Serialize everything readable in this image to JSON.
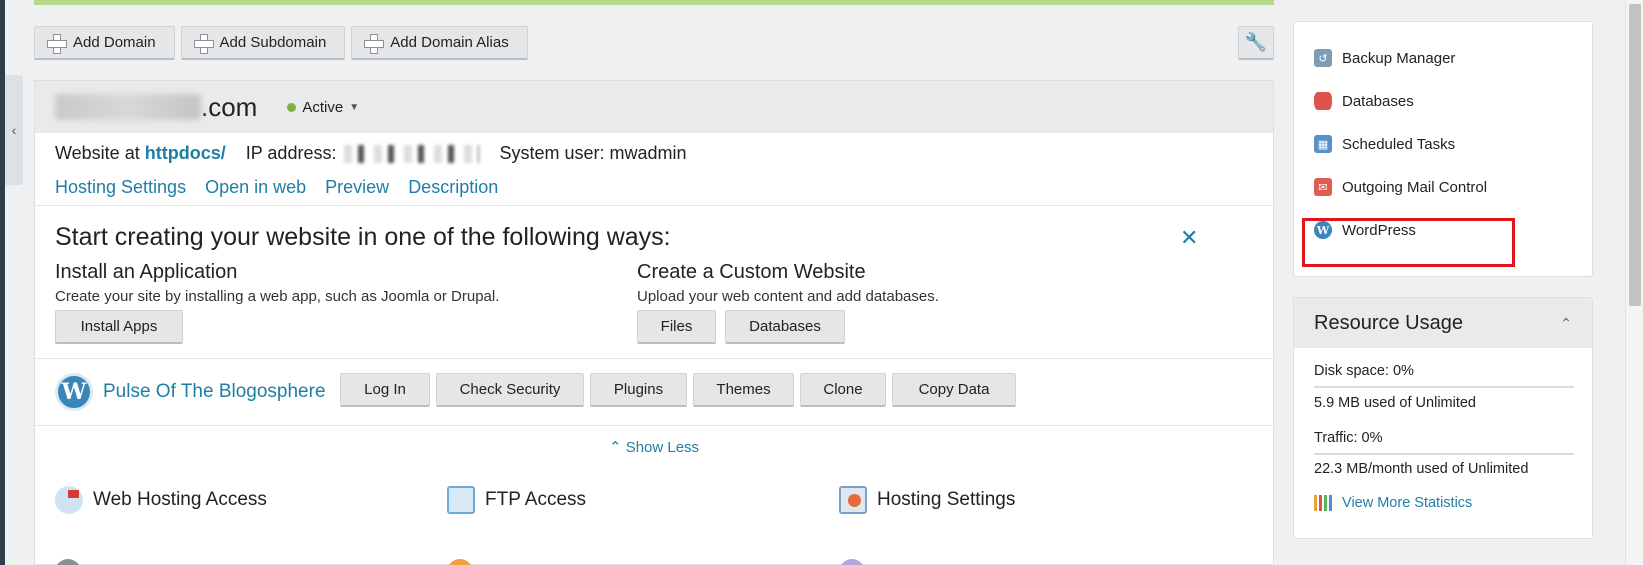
{
  "toolbar": {
    "add_domain": "Add Domain",
    "add_subdomain": "Add Subdomain",
    "add_domain_alias": "Add Domain Alias"
  },
  "domain": {
    "tld": ".com",
    "status": "Active"
  },
  "info": {
    "website_at": "Website at",
    "httpdocs": "httpdocs/",
    "ip_label": "IP address:",
    "system_user_label": "System user:",
    "system_user": "mwadmin"
  },
  "tabs": [
    "Hosting Settings",
    "Open in web",
    "Preview",
    "Description"
  ],
  "start": {
    "title": "Start creating your website in one of the following ways:",
    "install_title": "Install an Application",
    "install_desc": "Create your site by installing a web app, such as Joomla or Drupal.",
    "install_btn": "Install Apps",
    "custom_title": "Create a Custom Website",
    "custom_desc": "Upload your web content and add databases.",
    "files_btn": "Files",
    "databases_btn": "Databases"
  },
  "wordpress_site": {
    "name": "Pulse Of The Blogosphere",
    "buttons": [
      "Log In",
      "Check Security",
      "Plugins",
      "Themes",
      "Clone",
      "Copy Data"
    ]
  },
  "show_less": "Show Less",
  "features": [
    "Web Hosting Access",
    "FTP Access",
    "Hosting Settings"
  ],
  "sidebar": {
    "items": [
      "Backup Manager",
      "Databases",
      "Scheduled Tasks",
      "Outgoing Mail Control",
      "WordPress"
    ]
  },
  "resources": {
    "title": "Resource Usage",
    "disk_label": "Disk space:",
    "disk_value": "0%",
    "disk_detail": "5.9 MB used of Unlimited",
    "traffic_label": "Traffic:",
    "traffic_value": "0%",
    "traffic_detail": "22.3 MB/month used of Unlimited",
    "more_stats": "View More Statistics"
  },
  "colors": {
    "link": "#1f7ea6",
    "active_dot": "#7cb342",
    "highlight": "#e0161e"
  }
}
